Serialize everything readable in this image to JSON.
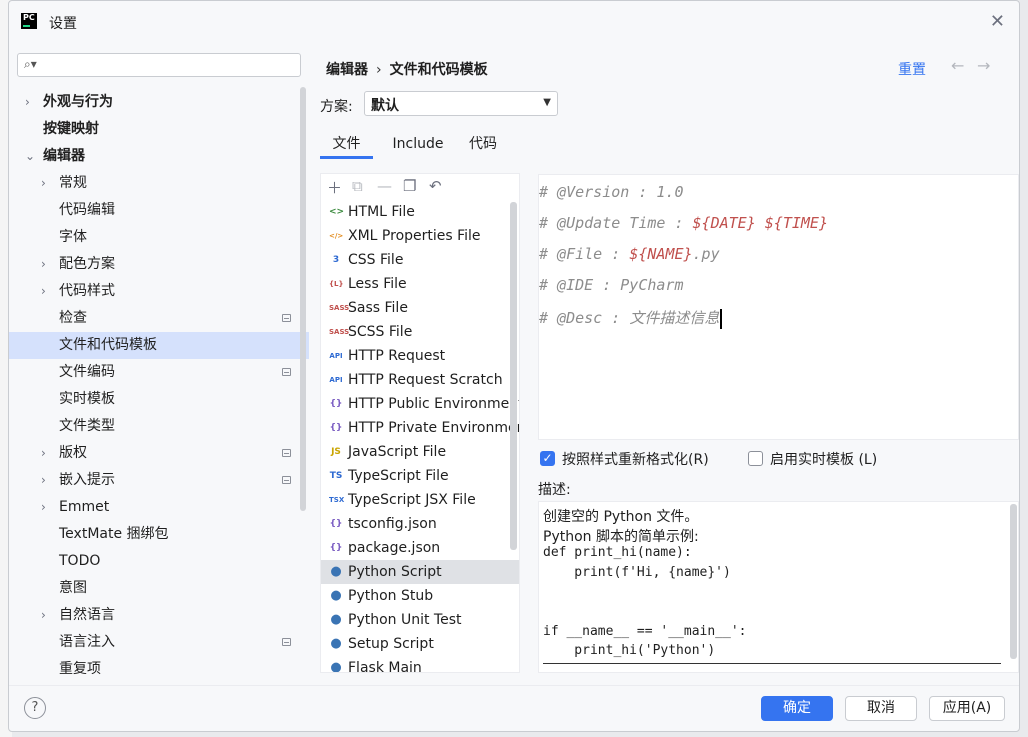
{
  "window": {
    "title": "设置",
    "close_glyph": "✕"
  },
  "search": {
    "placeholder": "",
    "icon": "search-icon"
  },
  "tree": [
    {
      "label": "外观与行为",
      "bold": true,
      "chevron": "›",
      "indent": 0
    },
    {
      "label": "按键映射",
      "bold": true,
      "indent": 0
    },
    {
      "label": "编辑器",
      "bold": true,
      "chevron": "⌄",
      "indent": 0
    },
    {
      "label": "常规",
      "chevron": "›",
      "indent": 1
    },
    {
      "label": "代码编辑",
      "indent": 1
    },
    {
      "label": "字体",
      "indent": 1
    },
    {
      "label": "配色方案",
      "chevron": "›",
      "indent": 1
    },
    {
      "label": "代码样式",
      "chevron": "›",
      "indent": 1
    },
    {
      "label": "检查",
      "indent": 1,
      "badge": true
    },
    {
      "label": "文件和代码模板",
      "indent": 1,
      "selected": true
    },
    {
      "label": "文件编码",
      "indent": 1,
      "badge": true
    },
    {
      "label": "实时模板",
      "indent": 1
    },
    {
      "label": "文件类型",
      "indent": 1
    },
    {
      "label": "版权",
      "chevron": "›",
      "indent": 1,
      "badge": true
    },
    {
      "label": "嵌入提示",
      "chevron": "›",
      "indent": 1,
      "badge": true
    },
    {
      "label": "Emmet",
      "chevron": "›",
      "indent": 1
    },
    {
      "label": "TextMate 捆绑包",
      "indent": 1
    },
    {
      "label": "TODO",
      "indent": 1
    },
    {
      "label": "意图",
      "indent": 1
    },
    {
      "label": "自然语言",
      "chevron": "›",
      "indent": 1
    },
    {
      "label": "语言注入",
      "indent": 1,
      "badge": true
    },
    {
      "label": "重复项",
      "indent": 1
    }
  ],
  "breadcrumb": {
    "part1": "编辑器",
    "sep": "›",
    "part2": "文件和代码模板"
  },
  "reset_label": "重置",
  "scheme": {
    "label": "方案:",
    "value": "默认"
  },
  "tabs": [
    "文件",
    "Include",
    "代码"
  ],
  "file_templates": [
    {
      "name": "HTML File",
      "icon": "<>",
      "color": "#3b8a3e"
    },
    {
      "name": "XML Properties File",
      "icon": "</>",
      "color": "#e28a1b"
    },
    {
      "name": "CSS File",
      "icon": "3",
      "color": "#2e6ad2"
    },
    {
      "name": "Less File",
      "icon": "{L}",
      "color": "#c0504d"
    },
    {
      "name": "Sass File",
      "icon": "SASS",
      "color": "#c0504d"
    },
    {
      "name": "SCSS File",
      "icon": "SASS",
      "color": "#c0504d"
    },
    {
      "name": "HTTP Request",
      "icon": "API",
      "color": "#2e6ad2"
    },
    {
      "name": "HTTP Request Scratch",
      "icon": "API",
      "color": "#2e6ad2"
    },
    {
      "name": "HTTP Public Environment File",
      "icon": "{}",
      "color": "#7a5cc2"
    },
    {
      "name": "HTTP Private Environment File",
      "icon": "{}",
      "color": "#7a5cc2"
    },
    {
      "name": "JavaScript File",
      "icon": "JS",
      "color": "#c9a400"
    },
    {
      "name": "TypeScript File",
      "icon": "TS",
      "color": "#2e6ad2"
    },
    {
      "name": "TypeScript JSX File",
      "icon": "TSX",
      "color": "#2e6ad2"
    },
    {
      "name": "tsconfig.json",
      "icon": "{}",
      "color": "#7a5cc2"
    },
    {
      "name": "package.json",
      "icon": "{}",
      "color": "#7a5cc2"
    },
    {
      "name": "Python Script",
      "icon": "py",
      "color": "#3a74b4",
      "selected": true
    },
    {
      "name": "Python Stub",
      "icon": "py",
      "color": "#3a74b4"
    },
    {
      "name": "Python Unit Test",
      "icon": "py",
      "color": "#3a74b4"
    },
    {
      "name": "Setup Script",
      "icon": "py",
      "color": "#3a74b4"
    },
    {
      "name": "Flask Main",
      "icon": "py",
      "color": "#3a74b4"
    }
  ],
  "editor_lines": [
    {
      "key": "# @Version        ",
      "colon": ": ",
      "value": "1.0"
    },
    {
      "key": "# @Update Time    ",
      "colon": ": ",
      "value": "${DATE} ${TIME}",
      "macro": true
    },
    {
      "key": "# @File           ",
      "colon": ": ",
      "value": "${NAME}",
      "macro": true,
      "suffix": ".py"
    },
    {
      "key": "# @IDE            ",
      "colon": ": ",
      "value": "PyCharm"
    },
    {
      "key": "# @Desc           ",
      "colon": ": ",
      "value": "文件描述信息"
    }
  ],
  "options": {
    "reformat_label": "按照样式重新格式化(R)",
    "reformat_checked": true,
    "live_templates_label": "启用实时模板 (L)",
    "live_templates_checked": false
  },
  "description": {
    "label": "描述:",
    "lines": [
      "创建空的 Python 文件。",
      "Python 脚本的简单示例:",
      "def print_hi(name):",
      "    print(f'Hi, {name}')",
      "",
      "",
      "if __name__ == '__main__':",
      "    print_hi('Python')"
    ]
  },
  "buttons": {
    "ok": "确定",
    "cancel": "取消",
    "apply": "应用(A)",
    "help": "?"
  },
  "colors": {
    "accent": "#3574f0",
    "selection": "#d5e1fc"
  }
}
